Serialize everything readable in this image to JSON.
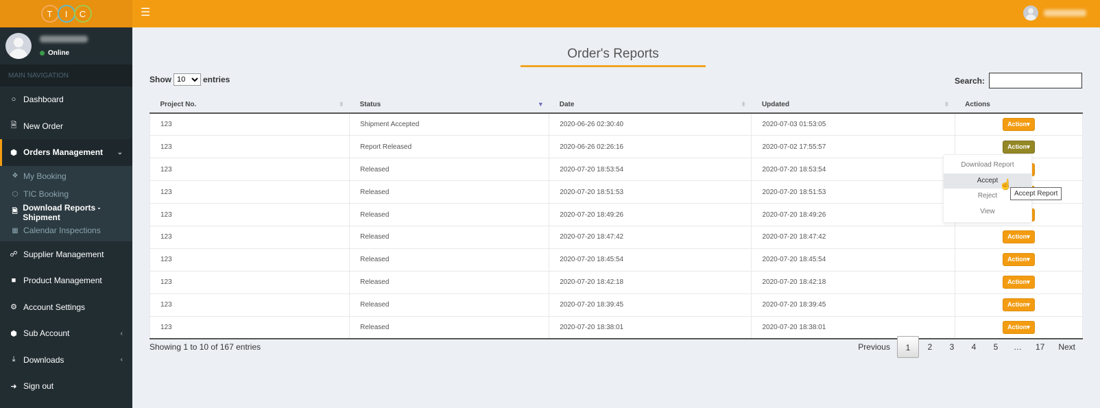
{
  "brand": {
    "logo_letters": [
      "T",
      "I",
      "C"
    ]
  },
  "header": {
    "menu_icon": "hamburger-icon"
  },
  "sidebar": {
    "user_status": "Online",
    "nav_header": "MAIN NAVIGATION",
    "items": [
      {
        "label": "Dashboard",
        "icon": "circle-icon"
      },
      {
        "label": "New Order",
        "icon": "file-icon"
      },
      {
        "label": "Orders Management",
        "icon": "cube-icon"
      },
      {
        "label": "Supplier Management",
        "icon": "handshake-icon"
      },
      {
        "label": "Product Management",
        "icon": "folder-icon"
      },
      {
        "label": "Account Settings",
        "icon": "gear-icon"
      },
      {
        "label": "Sub Account",
        "icon": "cube-icon"
      },
      {
        "label": "Downloads",
        "icon": "download-icon"
      },
      {
        "label": "Sign out",
        "icon": "sign-out-icon"
      }
    ],
    "submenu": [
      {
        "label": "My Booking",
        "icon": "cubes-icon"
      },
      {
        "label": "TIC Booking",
        "icon": "cube-icon"
      },
      {
        "label": "Download Reports - Shipment",
        "icon": "word-file-icon"
      },
      {
        "label": "Calendar Inspections",
        "icon": "calendar-icon"
      }
    ]
  },
  "main": {
    "title": "Order's Reports",
    "show_label": "Show",
    "entries_label": "entries",
    "page_length": "10",
    "search_label": "Search:",
    "search_value": "",
    "table": {
      "headers": [
        "Project No.",
        "Status",
        "Date",
        "Updated",
        "Actions"
      ],
      "rows": [
        {
          "project": "123",
          "status": "Shipment Accepted",
          "date": "2020-06-26 02:30:40",
          "updated": "2020-07-03 01:53:05",
          "action": "Action"
        },
        {
          "project": "123",
          "status": "Report Released",
          "date": "2020-06-26 02:26:16",
          "updated": "2020-07-02 17:55:57",
          "action": "Action"
        },
        {
          "project": "123",
          "status": "Released",
          "date": "2020-07-20 18:53:54",
          "updated": "2020-07-20 18:53:54",
          "action": "Action"
        },
        {
          "project": "123",
          "status": "Released",
          "date": "2020-07-20 18:51:53",
          "updated": "2020-07-20 18:51:53",
          "action": "Action"
        },
        {
          "project": "123",
          "status": "Released",
          "date": "2020-07-20 18:49:26",
          "updated": "2020-07-20 18:49:26",
          "action": "Action"
        },
        {
          "project": "123",
          "status": "Released",
          "date": "2020-07-20 18:47:42",
          "updated": "2020-07-20 18:47:42",
          "action": "Action"
        },
        {
          "project": "123",
          "status": "Released",
          "date": "2020-07-20 18:45:54",
          "updated": "2020-07-20 18:45:54",
          "action": "Action"
        },
        {
          "project": "123",
          "status": "Released",
          "date": "2020-07-20 18:42:18",
          "updated": "2020-07-20 18:42:18",
          "action": "Action"
        },
        {
          "project": "123",
          "status": "Released",
          "date": "2020-07-20 18:39:45",
          "updated": "2020-07-20 18:39:45",
          "action": "Action"
        },
        {
          "project": "123",
          "status": "Released",
          "date": "2020-07-20 18:38:01",
          "updated": "2020-07-20 18:38:01",
          "action": "Action"
        }
      ]
    },
    "dropdown": {
      "items": [
        "Download Report",
        "Accept",
        "Reject",
        "View"
      ],
      "hovered": "Accept",
      "tooltip": "Accept Report"
    },
    "info": "Showing 1 to 10 of 167 entries",
    "pagination": {
      "previous": "Previous",
      "pages": [
        "1",
        "2",
        "3",
        "4",
        "5",
        "…",
        "17"
      ],
      "current": "1",
      "next": "Next"
    }
  },
  "colors": {
    "accent": "#f39c12",
    "sidebar": "#222d32",
    "active_action": "#948726",
    "background": "#ecf0f5"
  }
}
